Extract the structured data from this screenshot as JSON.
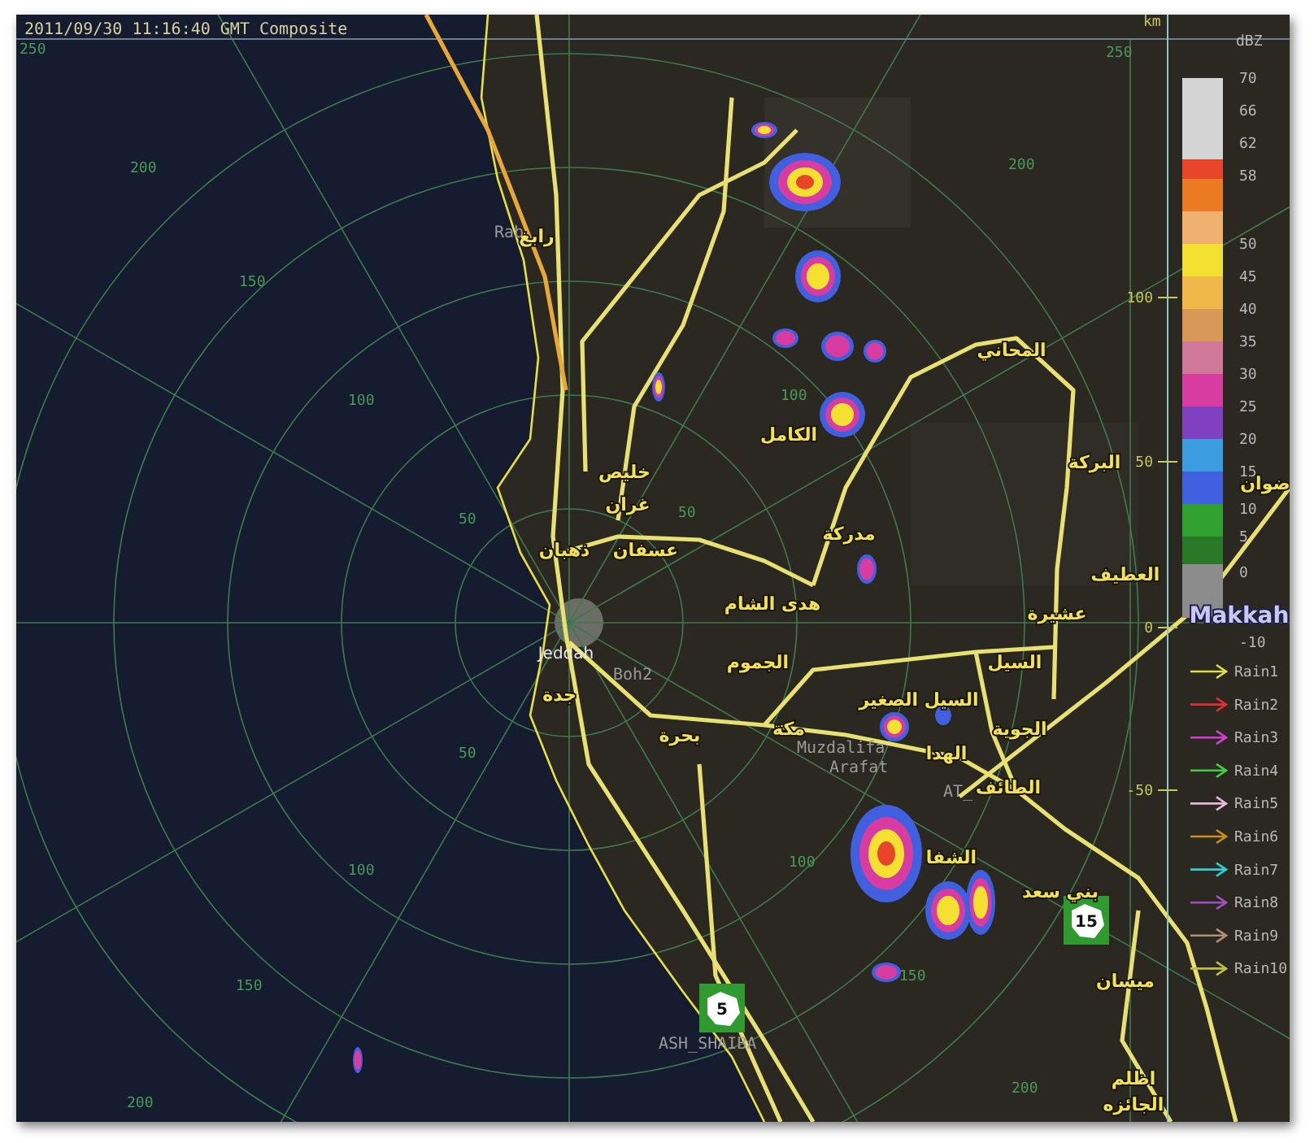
{
  "header": {
    "title": "2011/09/30 11:16:40 GMT Composite"
  },
  "map": {
    "radar_site": "Makkah",
    "place_labels": [
      {
        "text": "رابغ",
        "kind": "arabic"
      },
      {
        "text": "Rab",
        "kind": "latin"
      },
      {
        "text": "المحاني",
        "kind": "arabic"
      },
      {
        "text": "الكامل",
        "kind": "arabic"
      },
      {
        "text": "البركة",
        "kind": "arabic"
      },
      {
        "text": "خليص",
        "kind": "arabic"
      },
      {
        "text": "ضوان",
        "kind": "arabic"
      },
      {
        "text": "غران",
        "kind": "arabic"
      },
      {
        "text": "مدركة",
        "kind": "arabic"
      },
      {
        "text": "عسفان",
        "kind": "arabic"
      },
      {
        "text": "ذهبان",
        "kind": "arabic"
      },
      {
        "text": "العطيف",
        "kind": "arabic"
      },
      {
        "text": "هدى الشام",
        "kind": "arabic"
      },
      {
        "text": "عشيرة",
        "kind": "arabic"
      },
      {
        "text": "Jeddah",
        "kind": "city"
      },
      {
        "text": "السيل",
        "kind": "arabic"
      },
      {
        "text": "الجموم",
        "kind": "arabic"
      },
      {
        "text": "Boh2",
        "kind": "latin"
      },
      {
        "text": "جدة",
        "kind": "arabic"
      },
      {
        "text": "السيل الصغير",
        "kind": "arabic"
      },
      {
        "text": "الجوية",
        "kind": "arabic"
      },
      {
        "text": "مكة",
        "kind": "arabic"
      },
      {
        "text": "بحرة",
        "kind": "arabic"
      },
      {
        "text": "Muzdalifa",
        "kind": "latin"
      },
      {
        "text": "الهدا",
        "kind": "arabic"
      },
      {
        "text": "Arafat",
        "kind": "latin"
      },
      {
        "text": "الطائف",
        "kind": "arabic"
      },
      {
        "text": "AT_",
        "kind": "latin"
      },
      {
        "text": "الشفا",
        "kind": "arabic"
      },
      {
        "text": "بني سعد",
        "kind": "arabic"
      },
      {
        "text": "ميسان",
        "kind": "arabic"
      },
      {
        "text": "ASH_SHAIBA",
        "kind": "latin"
      },
      {
        "text": "اظلم",
        "kind": "arabic"
      },
      {
        "text": "الجائزه",
        "kind": "arabic"
      }
    ],
    "range_labels": [
      "250",
      "200",
      "150",
      "100",
      "50",
      "50",
      "100",
      "150",
      "200",
      "250",
      "200",
      "100",
      "50",
      "100",
      "150",
      "200"
    ],
    "road_signs": [
      {
        "number": "5"
      },
      {
        "number": "15"
      }
    ]
  },
  "km_axis": {
    "unit": "km",
    "ticks": [
      "100",
      "50",
      "0",
      "-50"
    ]
  },
  "dbz_scale": {
    "unit": "dBZ",
    "bands": [
      {
        "color": "#d4d4d4"
      },
      {
        "color": "#e8442a"
      },
      {
        "color": "#ec7a22"
      },
      {
        "color": "#f0b070"
      },
      {
        "color": "#f4e030"
      },
      {
        "color": "#f0b848"
      },
      {
        "color": "#d89858"
      },
      {
        "color": "#d07898"
      },
      {
        "color": "#d83ca0"
      },
      {
        "color": "#8040c0"
      },
      {
        "color": "#3c9ce0"
      },
      {
        "color": "#4060e0"
      },
      {
        "color": "#30a030"
      },
      {
        "color": "#287828"
      },
      {
        "color": "#8c8c8c"
      }
    ],
    "labels": [
      "70",
      "66",
      "62",
      "58",
      "50",
      "45",
      "40",
      "35",
      "30",
      "25",
      "20",
      "15",
      "10",
      "5",
      "0",
      "-10"
    ]
  },
  "rain_legend": [
    {
      "label": "Rain1",
      "color": "#e0e040"
    },
    {
      "label": "Rain2",
      "color": "#e03030"
    },
    {
      "label": "Rain3",
      "color": "#d040d0"
    },
    {
      "label": "Rain4",
      "color": "#40d040"
    },
    {
      "label": "Rain5",
      "color": "#e8b8d8"
    },
    {
      "label": "Rain6",
      "color": "#c89020"
    },
    {
      "label": "Rain7",
      "color": "#30d0d0"
    },
    {
      "label": "Rain8",
      "color": "#a050c0"
    },
    {
      "label": "Rain9",
      "color": "#b09070"
    },
    {
      "label": "Rain10",
      "color": "#c0c040"
    }
  ]
}
